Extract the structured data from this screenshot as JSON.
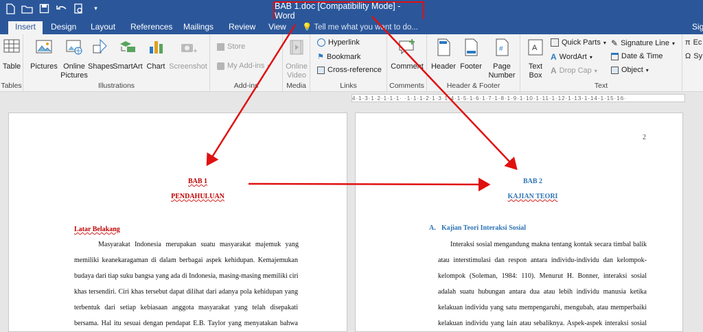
{
  "app": {
    "doc_title": "BAB 1.doc [Compatibility Mode] - Word"
  },
  "tabs": {
    "insert": "Insert",
    "design": "Design",
    "layout": "Layout",
    "references": "References",
    "mailings": "Mailings",
    "review": "Review",
    "view": "View",
    "tell_me": "Tell me what you want to do...",
    "signin": "Sig"
  },
  "ribbon": {
    "table": "Table",
    "tables_group": "Tables",
    "pictures": "Pictures",
    "online_pictures_1": "Online",
    "online_pictures_2": "Pictures",
    "shapes": "Shapes",
    "smartart": "SmartArt",
    "chart": "Chart",
    "screenshot": "Screenshot",
    "illustrations_group": "Illustrations",
    "store": "Store",
    "my_addins": "My Add-ins",
    "addins_group": "Add-ins",
    "online_video_1": "Online",
    "online_video_2": "Video",
    "media_group": "Media",
    "hyperlink": "Hyperlink",
    "bookmark": "Bookmark",
    "cross_reference": "Cross-reference",
    "links_group": "Links",
    "comment": "Comment",
    "comments_group": "Comments",
    "header": "Header",
    "footer": "Footer",
    "page_number_1": "Page",
    "page_number_2": "Number",
    "header_footer_group": "Header & Footer",
    "text_box_1": "Text",
    "text_box_2": "Box",
    "quick_parts": "Quick Parts",
    "wordart": "WordArt",
    "drop_cap": "Drop Cap",
    "signature_line": "Signature Line",
    "date_time": "Date & Time",
    "object": "Object",
    "text_group": "Text",
    "equation": "Ec",
    "symbol": "Sy"
  },
  "ruler": {
    "marks": "4·1·3·1·2·1·1·1· ·1·1·1·2·1·3·1·4·1·5·1·6·1·7·1·8·1·9·1·10·1·11·1·12·1·13·1·14·1·15·16·"
  },
  "page1": {
    "heading1": "BAB 1",
    "heading2": "PENDAHULUAN",
    "section": "Latar Belakang",
    "lines": [
      "Masyarakat Indonesia merupakan suatu masyarakat majemuk yang",
      "memiliki keanekaragaman di dalam berbagai aspek kehidupan. Kemajemukan",
      "budaya dari tiap suku bangsa yang ada di Indonesia, masing-masing memiliki ciri",
      "khas tersendiri. Ciri khas tersebut dapat dilihat dari adanya pola kehidupan yang",
      "terbentuk dari setiap kebiasaan anggota masyarakat yang telah disepakati",
      "bersama. Hal itu sesuai dengan pendapat E.B. Taylor yang menyatakan bahwa"
    ]
  },
  "page2": {
    "page_number": "2",
    "heading1": "BAB 2",
    "heading2": "KAJIAN TEORI",
    "section_letter": "A.",
    "section": "Kajian Teori Interaksi Sosial",
    "lines": [
      "Interaksi sosial mengandung makna tentang kontak secara timbal balik",
      "atau interstimulasi dan respon antara individu-individu dan kelompok-",
      "kelompok (Soleman, 1984: 110). Menurut H. Bonner, interaksi sosial",
      "adalah suatu hubungan antara dua atau lebih individu manusia ketika",
      "kelakuan individu yang satu mempengaruhi, mengubah, atau memperbaiki",
      "kelakuan individu yang lain atau sebaliknya. Aspek-aspek interaksi sosial"
    ]
  },
  "colors": {
    "brand": "#2b579a",
    "annotation": "#e01010",
    "heading_red": "#c00000",
    "heading_blue": "#2e74b5"
  }
}
